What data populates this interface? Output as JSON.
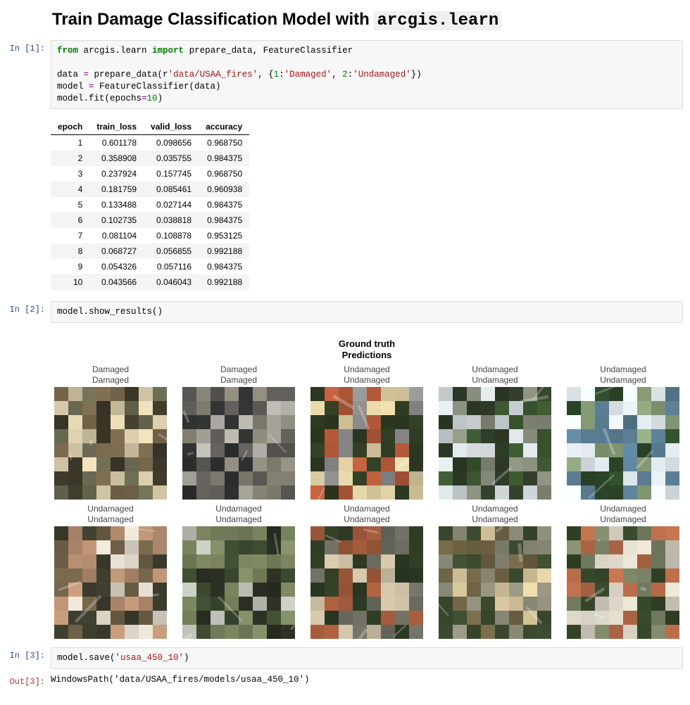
{
  "title_prefix": "Train Damage Classification Model with ",
  "title_code": "arcgis.learn",
  "cells": {
    "c1": {
      "prompt": "In [1]:",
      "code": {
        "l1a": "from",
        "l1b": " arcgis.learn ",
        "l1c": "import",
        "l1d": " prepare_data, FeatureClassifier",
        "l3a": "data ",
        "l3b": "=",
        "l3c": " prepare_data(r",
        "l3d": "'data/USAA_fires'",
        "l3e": ", {",
        "l3f": "1",
        "l3g": ":",
        "l3h": "'Damaged'",
        "l3i": ", ",
        "l3j": "2",
        "l3k": ":",
        "l3l": "'Undamaged'",
        "l3m": "})",
        "l4a": "model ",
        "l4b": "=",
        "l4c": " FeatureClassifier(data)",
        "l5a": "model.fit(epochs",
        "l5b": "=",
        "l5c": "10",
        "l5d": ")"
      }
    },
    "c2": {
      "prompt": "In [2]:",
      "code": "model.show_results()"
    },
    "c3": {
      "prompt": "In [3]:",
      "code_a": "model.save(",
      "code_b": "'usaa_450_10'",
      "code_c": ")"
    },
    "out3": {
      "prompt": "Out[3]:",
      "text": "WindowsPath('data/USAA_fires/models/usaa_450_10')"
    }
  },
  "training_table": {
    "headers": [
      "epoch",
      "train_loss",
      "valid_loss",
      "accuracy"
    ],
    "rows": [
      [
        "1",
        "0.601178",
        "0.098656",
        "0.968750"
      ],
      [
        "2",
        "0.358908",
        "0.035755",
        "0.984375"
      ],
      [
        "3",
        "0.237924",
        "0.157745",
        "0.968750"
      ],
      [
        "4",
        "0.181759",
        "0.085461",
        "0.960938"
      ],
      [
        "5",
        "0.133488",
        "0.027144",
        "0.984375"
      ],
      [
        "6",
        "0.102735",
        "0.038818",
        "0.984375"
      ],
      [
        "7",
        "0.081104",
        "0.108878",
        "0.953125"
      ],
      [
        "8",
        "0.068727",
        "0.056855",
        "0.992188"
      ],
      [
        "9",
        "0.054326",
        "0.057116",
        "0.984375"
      ],
      [
        "10",
        "0.043566",
        "0.046043",
        "0.992188"
      ]
    ]
  },
  "results": {
    "header1": "Ground truth",
    "header2": "Predictions",
    "row1": [
      {
        "gt": "Damaged",
        "pr": "Damaged",
        "palette": [
          "#7a6a4f",
          "#d9cbaa",
          "#6b6b53",
          "#3e3a2a"
        ],
        "seed": 11
      },
      {
        "gt": "Damaged",
        "pr": "Damaged",
        "palette": [
          "#5d5a56",
          "#b7b4ab",
          "#2e3030",
          "#8a8678"
        ],
        "seed": 22
      },
      {
        "gt": "Undamaged",
        "pr": "Undamaged",
        "palette": [
          "#2f3b23",
          "#b45a3a",
          "#8e8e8e",
          "#d9cba0"
        ],
        "seed": 33
      },
      {
        "gt": "Undamaged",
        "pr": "Undamaged",
        "palette": [
          "#3b5530",
          "#cfd6d8",
          "#888d7c",
          "#2e3a27"
        ],
        "seed": 44
      },
      {
        "gt": "Undamaged",
        "pr": "Undamaged",
        "palette": [
          "#2e4a2b",
          "#eaf2f7",
          "#5c7f96",
          "#8aa07a"
        ],
        "seed": 55
      }
    ],
    "row2": [
      {
        "gt": "Undamaged",
        "pr": "Undamaged",
        "palette": [
          "#b89072",
          "#3b3b2d",
          "#d9d2c5",
          "#6f6148"
        ],
        "seed": 66
      },
      {
        "gt": "Undamaged",
        "pr": "Undamaged",
        "palette": [
          "#3c4a30",
          "#b9bdb3",
          "#7a8560",
          "#2a2e22"
        ],
        "seed": 77
      },
      {
        "gt": "Undamaged",
        "pr": "Undamaged",
        "palette": [
          "#2e3b24",
          "#a35b3b",
          "#6e6e63",
          "#c9bda3"
        ],
        "seed": 88
      },
      {
        "gt": "Undamaged",
        "pr": "Undamaged",
        "palette": [
          "#d9c89e",
          "#3b4a2f",
          "#8c8a78",
          "#6e6344"
        ],
        "seed": 99
      },
      {
        "gt": "Undamaged",
        "pr": "Undamaged",
        "palette": [
          "#bb6e4b",
          "#334428",
          "#7c8568",
          "#d5d0c1"
        ],
        "seed": 110
      }
    ]
  }
}
